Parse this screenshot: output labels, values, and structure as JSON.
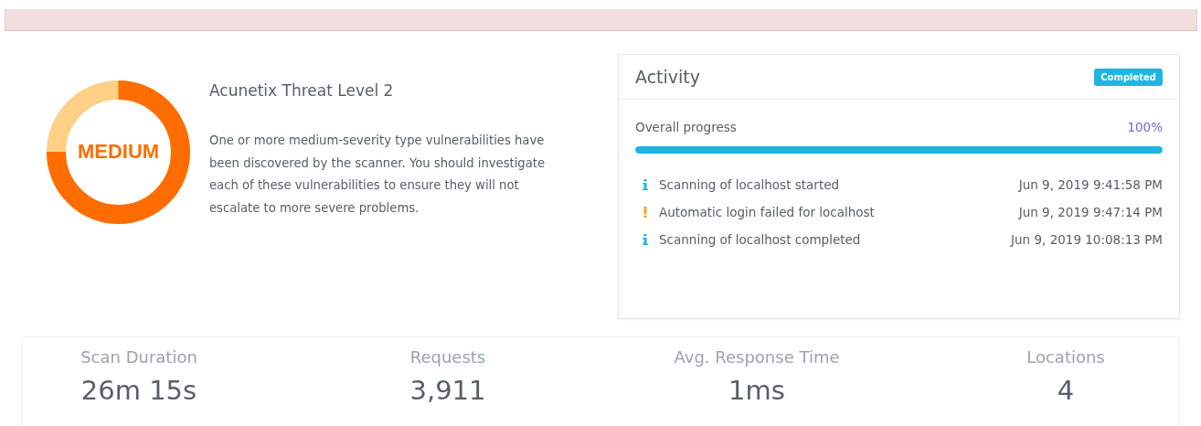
{
  "alert_banner": {
    "kind": "error"
  },
  "threat": {
    "label": "MEDIUM",
    "title": "Acunetix Threat Level 2",
    "description": "One or more medium-severity type vulnerabilities have been discovered by the scanner. You should investigate each of these vulnerabilities to ensure they will not escalate to more severe problems."
  },
  "activity": {
    "title": "Activity",
    "status": "Completed",
    "progress_label": "Overall progress",
    "progress_value": "100%",
    "level": 1,
    "events": [
      {
        "kind": "info",
        "text": "Scanning of localhost started",
        "time": "Jun 9, 2019 9:41:58 PM"
      },
      {
        "kind": "warning",
        "text": "Automatic login failed for localhost",
        "time": "Jun 9, 2019 9:47:14 PM"
      },
      {
        "kind": "info",
        "text": "Scanning of localhost completed",
        "time": "Jun 9, 2019 10:08:13 PM"
      }
    ]
  },
  "stats": [
    {
      "label": "Scan Duration",
      "value": "26m 15s"
    },
    {
      "label": "Requests",
      "value": "3,911"
    },
    {
      "label": "Avg. Response Time",
      "value": "1ms"
    },
    {
      "label": "Locations",
      "value": "4"
    }
  ]
}
